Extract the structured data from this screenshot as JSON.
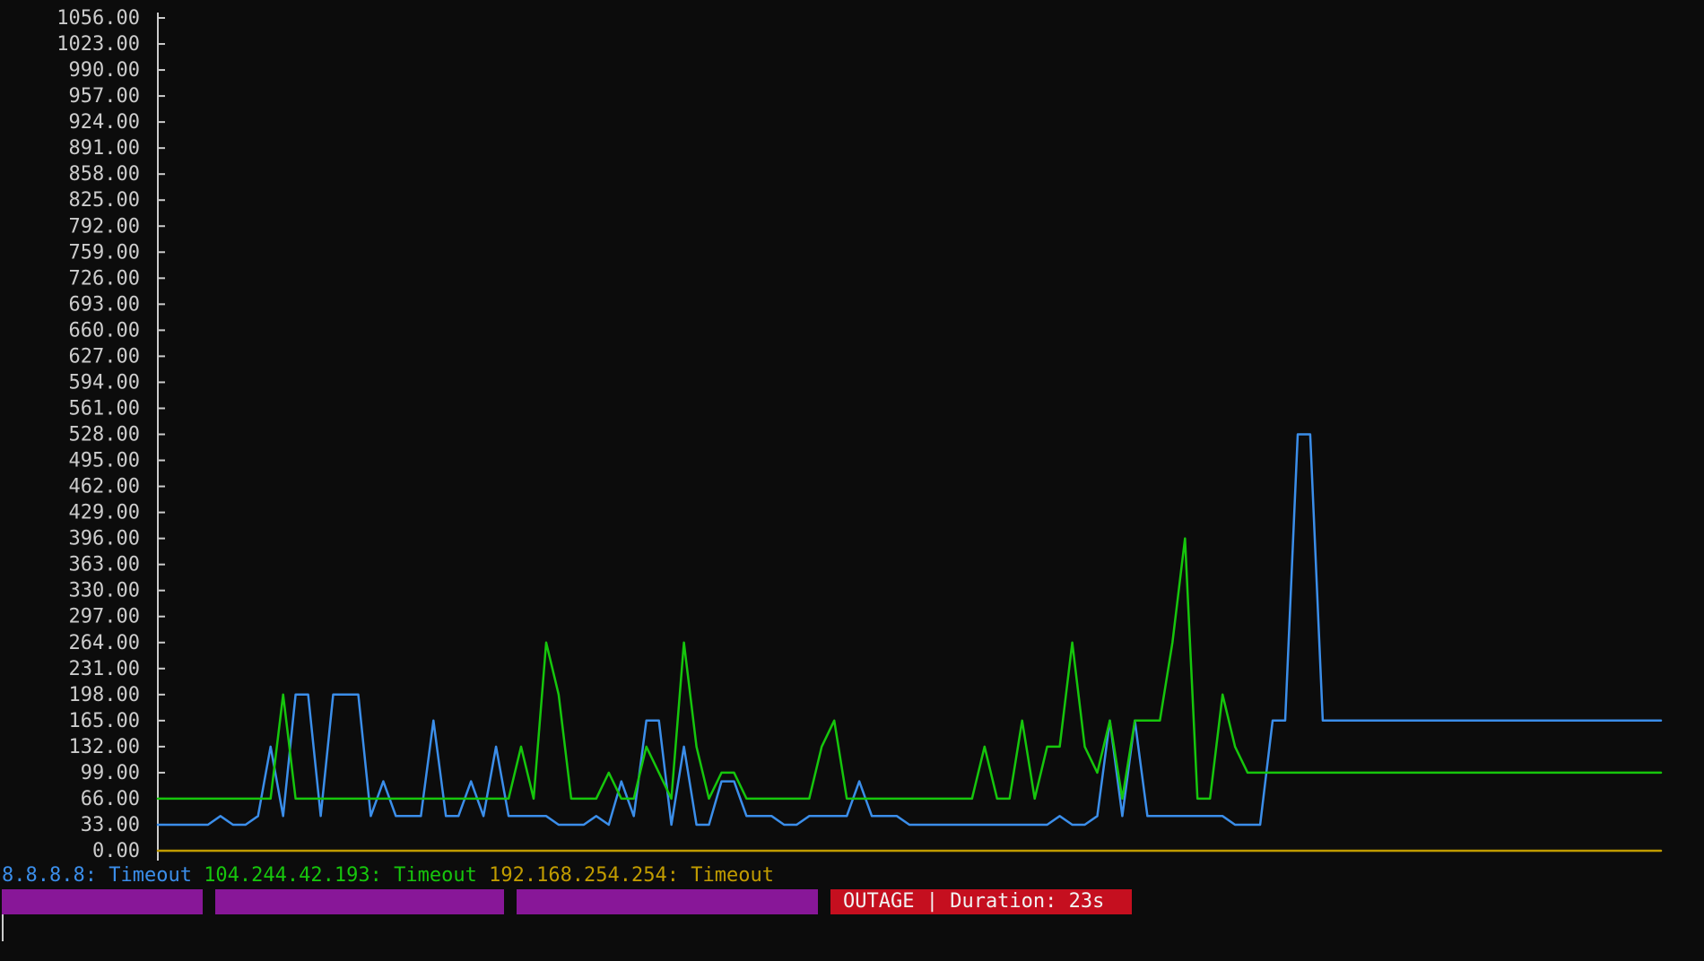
{
  "colors": {
    "background": "#0c0c0c",
    "axis_text": "#cccccc",
    "host1": "#3b8eea",
    "host2": "#16c60c",
    "host3": "#c19c00",
    "bar": "#881798",
    "outage": "#c50f1f"
  },
  "status": {
    "host1_label": "8.8.8.8:",
    "host1_status": "Timeout",
    "host2_label": "104.244.42.193:",
    "host2_status": "Timeout",
    "host3_label": "192.168.254.254:",
    "host3_status": "Timeout",
    "outage_text": "OUTAGE | Duration: 23s"
  },
  "chart_data": {
    "type": "line",
    "y_ticks": [
      "0.00",
      "33.00",
      "66.00",
      "99.00",
      "132.00",
      "165.00",
      "198.00",
      "231.00",
      "264.00",
      "297.00",
      "330.00",
      "363.00",
      "396.00",
      "429.00",
      "462.00",
      "495.00",
      "528.00",
      "561.00",
      "594.00",
      "627.00",
      "660.00",
      "693.00",
      "726.00",
      "759.00",
      "792.00",
      "825.00",
      "858.00",
      "891.00",
      "924.00",
      "957.00",
      "990.00",
      "1023.00",
      "1056.00"
    ],
    "ylim": [
      0,
      1056
    ],
    "x": [
      0,
      1,
      2,
      3,
      4,
      5,
      6,
      7,
      8,
      9,
      10,
      11,
      12,
      13,
      14,
      15,
      16,
      17,
      18,
      19,
      20,
      21,
      22,
      23,
      24,
      25,
      26,
      27,
      28,
      29,
      30,
      31,
      32,
      33,
      34,
      35,
      36,
      37,
      38,
      39,
      40,
      41,
      42,
      43,
      44,
      45,
      46,
      47,
      48,
      49,
      50,
      51,
      52,
      53,
      54,
      55,
      56,
      57,
      58,
      59,
      60,
      61,
      62,
      63,
      64,
      65,
      66,
      67,
      68,
      69,
      70,
      71,
      72,
      73,
      74,
      75,
      76,
      77,
      78,
      79,
      80,
      81,
      82,
      83,
      84,
      85,
      86,
      87,
      88,
      89,
      90,
      91,
      92,
      93,
      94,
      95,
      96,
      97,
      98,
      99,
      100,
      101,
      102,
      103,
      104,
      105,
      106,
      107,
      108,
      109,
      110,
      111,
      112,
      113,
      114,
      115,
      116,
      117,
      118,
      119,
      120
    ],
    "series": [
      {
        "name": "8.8.8.8",
        "values": [
          33,
          33,
          33,
          33,
          33,
          44,
          33,
          33,
          44,
          132,
          44,
          198,
          198,
          44,
          198,
          198,
          198,
          44,
          88,
          44,
          44,
          44,
          165,
          44,
          44,
          88,
          44,
          132,
          44,
          44,
          44,
          44,
          33,
          33,
          33,
          44,
          33,
          88,
          44,
          165,
          165,
          33,
          132,
          33,
          33,
          88,
          88,
          44,
          44,
          44,
          33,
          33,
          44,
          44,
          44,
          44,
          88,
          44,
          44,
          44,
          33,
          33,
          33,
          33,
          33,
          33,
          33,
          33,
          33,
          33,
          33,
          33,
          44,
          33,
          33,
          44,
          165,
          44,
          165,
          44,
          44,
          44,
          44,
          44,
          44,
          44,
          33,
          33,
          33,
          165,
          165,
          528,
          528,
          165,
          165,
          165,
          165,
          165,
          165,
          165,
          165,
          165,
          165,
          165,
          165,
          165,
          165,
          165,
          165,
          165,
          165,
          165,
          165,
          165,
          165,
          165,
          165,
          165,
          165,
          165,
          165
        ]
      },
      {
        "name": "104.244.42.193",
        "values": [
          66,
          66,
          66,
          66,
          66,
          66,
          66,
          66,
          66,
          66,
          198,
          66,
          66,
          66,
          66,
          66,
          66,
          66,
          66,
          66,
          66,
          66,
          66,
          66,
          66,
          66,
          66,
          66,
          66,
          132,
          66,
          264,
          198,
          66,
          66,
          66,
          99,
          66,
          66,
          132,
          99,
          66,
          264,
          132,
          66,
          99,
          99,
          66,
          66,
          66,
          66,
          66,
          66,
          132,
          165,
          66,
          66,
          66,
          66,
          66,
          66,
          66,
          66,
          66,
          66,
          66,
          132,
          66,
          66,
          165,
          66,
          132,
          132,
          264,
          132,
          99,
          165,
          66,
          165,
          165,
          165,
          264,
          396,
          66,
          66,
          198,
          132,
          99,
          99,
          99,
          99,
          99,
          99,
          99,
          99,
          99,
          99,
          99,
          99,
          99,
          99,
          99,
          99,
          99,
          99,
          99,
          99,
          99,
          99,
          99,
          99,
          99,
          99,
          99,
          99,
          99,
          99,
          99,
          99,
          99,
          99
        ]
      },
      {
        "name": "192.168.254.254",
        "values": [
          0,
          0,
          0,
          0,
          0,
          0,
          0,
          0,
          0,
          0,
          0,
          0,
          0,
          0,
          0,
          0,
          0,
          0,
          0,
          0,
          0,
          0,
          0,
          0,
          0,
          0,
          0,
          0,
          0,
          0,
          0,
          0,
          0,
          0,
          0,
          0,
          0,
          0,
          0,
          0,
          0,
          0,
          0,
          0,
          0,
          0,
          0,
          0,
          0,
          0,
          0,
          0,
          0,
          0,
          0,
          0,
          0,
          0,
          0,
          0,
          0,
          0,
          0,
          0,
          0,
          0,
          0,
          0,
          0,
          0,
          0,
          0,
          0,
          0,
          0,
          0,
          0,
          0,
          0,
          0,
          0,
          0,
          0,
          0,
          0,
          0,
          0,
          0,
          0,
          0,
          0,
          0,
          0,
          0,
          0,
          0,
          0,
          0,
          0,
          0,
          0,
          0,
          0,
          0,
          0,
          0,
          0,
          0,
          0,
          0,
          0,
          0,
          0,
          0,
          0,
          0,
          0,
          0,
          0,
          0,
          0
        ]
      }
    ]
  }
}
